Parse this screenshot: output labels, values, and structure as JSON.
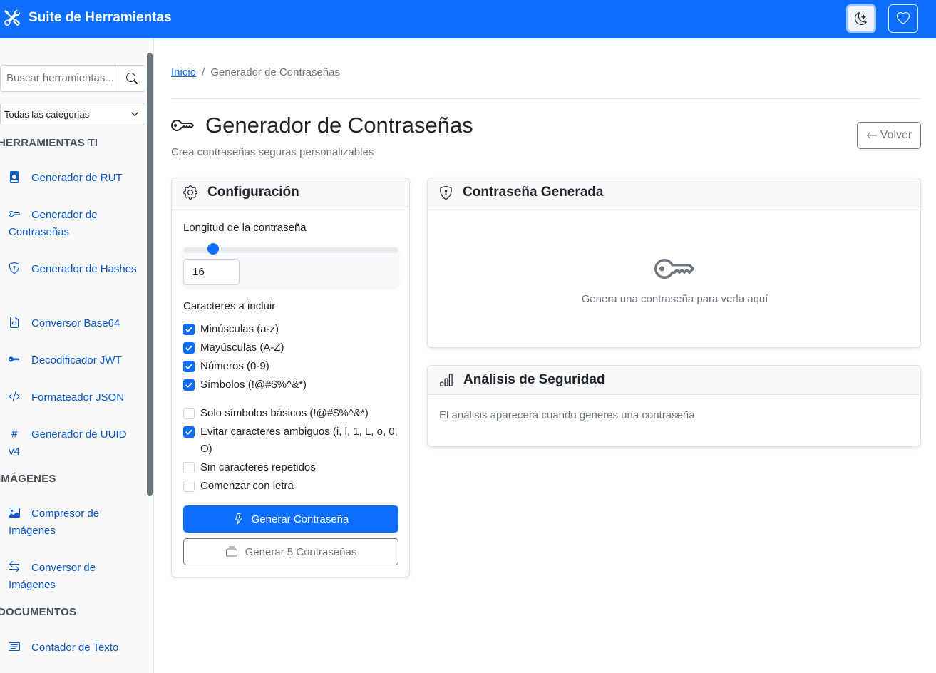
{
  "navbar": {
    "title": "Suite de Herramientas",
    "icons": {
      "brand": "tools-icon",
      "theme": "moon-stars-icon",
      "favorites": "heart-icon"
    }
  },
  "sidebar": {
    "search_placeholder": "Buscar herramientas...",
    "category_select": "Todas las categorías",
    "sections": [
      {
        "title": "HERRAMIENTAS TI",
        "items": [
          {
            "label": "Generador de RUT",
            "icon": "person-badge-icon"
          },
          {
            "label": "Generador de Contraseñas",
            "icon": "key-icon"
          },
          {
            "label": "Generador de Hashes",
            "icon": "shield-lock-icon"
          },
          {
            "label": "Conversor Base64",
            "icon": "file-code-icon"
          },
          {
            "label": "Decodificador JWT",
            "icon": "key-fill-icon"
          },
          {
            "label": "Formateador JSON",
            "icon": "code-slash-icon"
          },
          {
            "label": "Generador de UUID v4",
            "icon": "hash-icon"
          }
        ]
      },
      {
        "title": "IMÁGENES",
        "items": [
          {
            "label": "Compresor de Imágenes",
            "icon": "image-icon"
          },
          {
            "label": "Conversor de Imágenes",
            "icon": "arrow-left-right-icon"
          }
        ]
      },
      {
        "title": "DOCUMENTOS",
        "items": [
          {
            "label": "Contador de Texto",
            "icon": "text-card-icon"
          }
        ]
      }
    ]
  },
  "breadcrumb": {
    "home": "Inicio",
    "separator": "/",
    "current": "Generador de Contraseñas"
  },
  "page": {
    "title": "Generador de Contraseñas",
    "subtitle": "Crea contraseñas seguras personalizables",
    "back_label": "Volver"
  },
  "config": {
    "header": "Configuración",
    "length_label": "Longitud de la contraseña",
    "length_value": "16",
    "length_slider_fraction": 0.12,
    "chars_label": "Caracteres a incluir",
    "options": [
      {
        "label": "Minúsculas (a-z)",
        "checked": true
      },
      {
        "label": "Mayúsculas (A-Z)",
        "checked": true
      },
      {
        "label": "Números (0-9)",
        "checked": true
      },
      {
        "label": "Símbolos (!@#$%^&*)",
        "checked": true
      }
    ],
    "extra_options": [
      {
        "label": "Solo símbolos básicos (!@#$%^&*)",
        "checked": false
      },
      {
        "label": "Evitar caracteres ambiguos (i, l, 1, L, o, 0, O)",
        "checked": true
      },
      {
        "label": "Sin caracteres repetidos",
        "checked": false
      },
      {
        "label": "Comenzar con letra",
        "checked": false
      }
    ],
    "generate_label": "Generar Contraseña",
    "generate5_label": "Generar 5 Contraseñas"
  },
  "generated": {
    "header": "Contraseña Generada",
    "placeholder": "Genera una contraseña para verla aquí"
  },
  "analysis": {
    "header": "Análisis de Seguridad",
    "placeholder": "El análisis aparecerá cuando generes una contraseña"
  },
  "colors": {
    "primary": "#0d6efd",
    "link": "#0a58ca",
    "muted": "#6c757d"
  }
}
